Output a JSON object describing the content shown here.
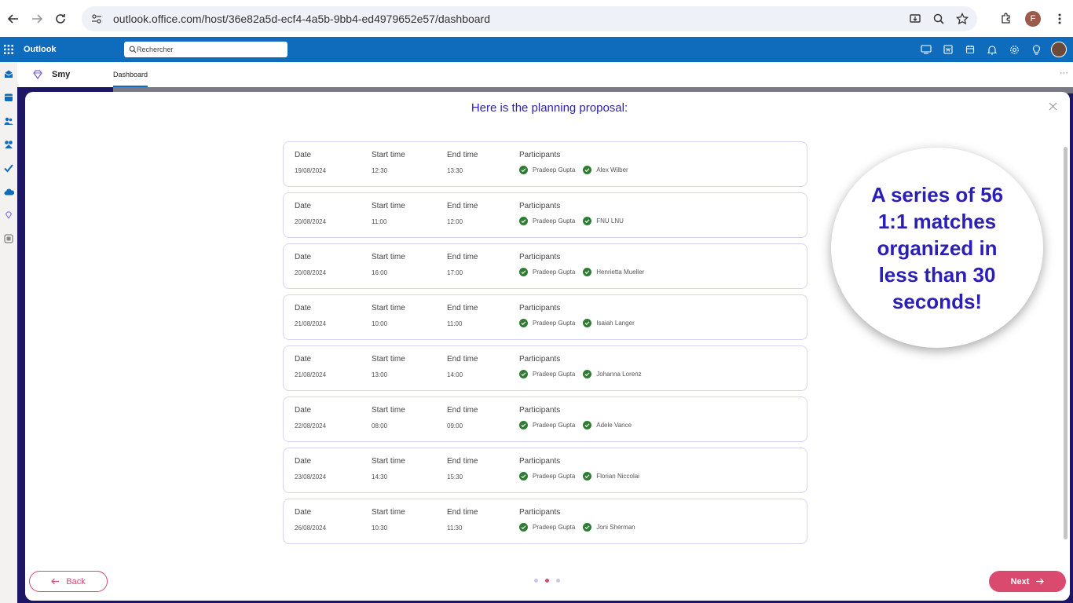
{
  "browser": {
    "url": "outlook.office.com/host/36e82a5d-ecf4-4a5b-9bb4-ed4979652e57/dashboard",
    "profile_initial": "F"
  },
  "outlook": {
    "title": "Outlook",
    "search_placeholder": "Rechercher"
  },
  "app": {
    "name": "Smy",
    "tab": "Dashboard",
    "more": "···"
  },
  "modal": {
    "title": "Here is the planning proposal:",
    "labels": {
      "date": "Date",
      "start": "Start time",
      "end": "End time",
      "participants": "Participants"
    },
    "rows": [
      {
        "date": "19/08/2024",
        "start": "12:30",
        "end": "13:30",
        "p1": "Pradeep Gupta",
        "p2": "Alex Wilber"
      },
      {
        "date": "20/08/2024",
        "start": "11:00",
        "end": "12:00",
        "p1": "Pradeep Gupta",
        "p2": "FNU LNU"
      },
      {
        "date": "20/08/2024",
        "start": "16:00",
        "end": "17:00",
        "p1": "Pradeep Gupta",
        "p2": "Henrietta Mueller"
      },
      {
        "date": "21/08/2024",
        "start": "10:00",
        "end": "11:00",
        "p1": "Pradeep Gupta",
        "p2": "Isaiah Langer"
      },
      {
        "date": "21/08/2024",
        "start": "13:00",
        "end": "14:00",
        "p1": "Pradeep Gupta",
        "p2": "Johanna Lorenz"
      },
      {
        "date": "22/08/2024",
        "start": "08:00",
        "end": "09:00",
        "p1": "Pradeep Gupta",
        "p2": "Adele Vance"
      },
      {
        "date": "23/08/2024",
        "start": "14:30",
        "end": "15:30",
        "p1": "Pradeep Gupta",
        "p2": "Florian Niccolai"
      },
      {
        "date": "26/08/2024",
        "start": "10:30",
        "end": "11:30",
        "p1": "Pradeep Gupta",
        "p2": "Joni Sherman"
      }
    ],
    "callout": "A series of 56 1:1 matches organized in less than 30 seconds!",
    "back_label": "Back",
    "next_label": "Next",
    "page_current": 2,
    "page_total": 3
  },
  "colors": {
    "outlook_blue": "#0f6cbd",
    "accent_purple": "#2b1fb5",
    "button_pink": "#d94a6e",
    "check_green": "#2e7d32"
  }
}
